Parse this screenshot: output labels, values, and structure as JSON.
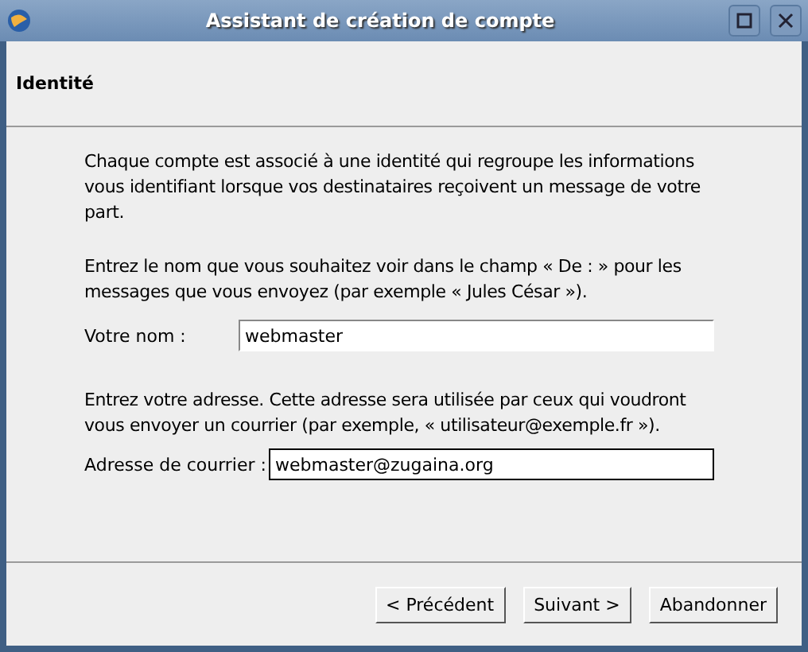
{
  "window": {
    "title": "Assistant de création de compte"
  },
  "page": {
    "heading": "Identité"
  },
  "paragraphs": [
    "Chaque compte est associé à une identité qui regroupe les informations vous identifiant lorsque vos destinataires reçoivent un message de votre part.",
    "Entrez le nom que vous souhaitez voir dans le champ « De : » pour les messages que vous envoyez (par exemple « Jules César »).",
    "Entrez votre adresse. Cette adresse sera utilisée par ceux qui voudront vous envoyer un courrier (par exemple, « utilisateur@exemple.fr »)."
  ],
  "fields": [
    {
      "label": "Votre nom :",
      "value": "webmaster",
      "focused": false
    },
    {
      "label": "Adresse de courrier :",
      "value": "webmaster@zugaina.org",
      "focused": true
    }
  ],
  "buttons": [
    "< Précédent",
    "Suivant >",
    "Abandonner"
  ]
}
